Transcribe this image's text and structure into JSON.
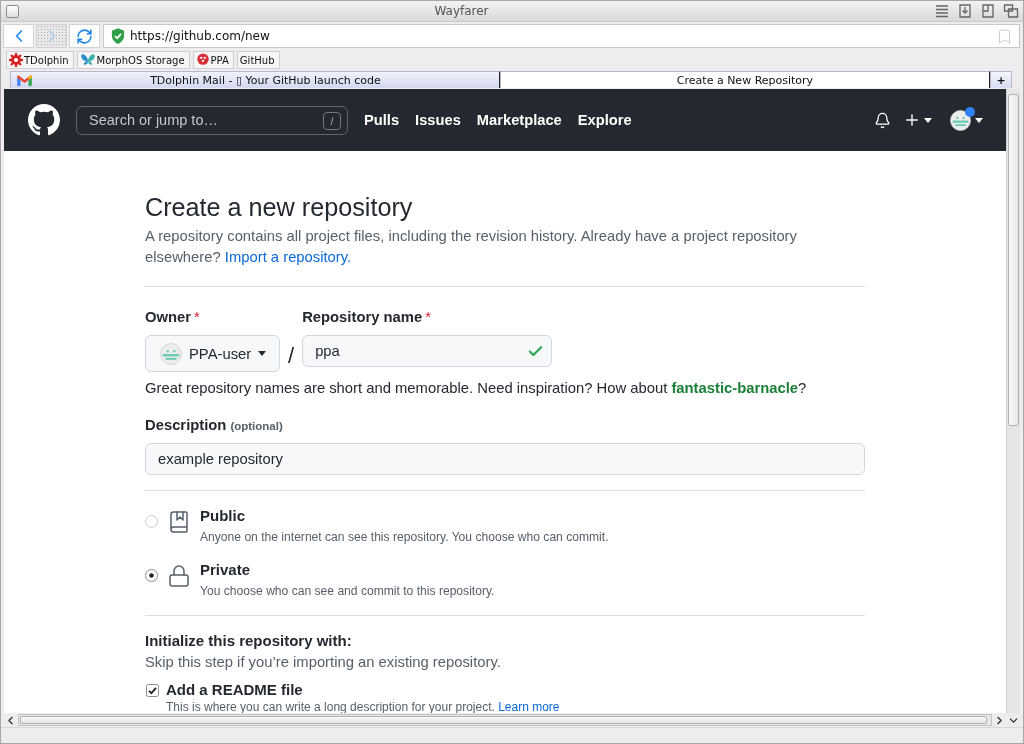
{
  "window": {
    "title": "Wayfarer"
  },
  "nav_buttons": [
    {
      "kind": "back",
      "disabled": false
    },
    {
      "kind": "forward",
      "disabled": true
    },
    {
      "kind": "reload",
      "disabled": false
    }
  ],
  "address_bar": {
    "url": "https://github.com/new",
    "secure": true
  },
  "bookmarks": [
    {
      "kind": "gear",
      "label": "TDolphin"
    },
    {
      "kind": "butterfly",
      "label": "MorphOS Storage"
    },
    {
      "kind": "badge",
      "label": "PPA"
    },
    {
      "kind": "plain",
      "label": "GitHub"
    }
  ],
  "tabs": [
    {
      "kind": "mail",
      "title": "TDolphin Mail - ▯ Your GitHub launch code",
      "selected": false
    },
    {
      "kind": "plain",
      "title": "Create a New Repository",
      "selected": true
    }
  ],
  "new_tab": "+",
  "github_header": {
    "search_placeholder": "Search or jump to…",
    "search_key": "/",
    "links": [
      "Pulls",
      "Issues",
      "Marketplace",
      "Explore"
    ],
    "avatar_badge": true
  },
  "page": {
    "title": "Create a new repository",
    "intro": "A repository contains all project files, including the revision history. Already have a project repository elsewhere?",
    "import_link": "Import a repository.",
    "owner": {
      "label": "Owner",
      "required_mark": "*",
      "value": "PPA-user"
    },
    "separator": "/",
    "repository_name": {
      "label": "Repository name",
      "required_mark": "*",
      "value": "ppa",
      "valid": true
    },
    "name_hint": "Great repository names are short and memorable. Need inspiration? How about **fantastic-barnacle**?",
    "description": {
      "label": "Description",
      "note": "(optional)",
      "value": "example repository"
    },
    "visibility": [
      {
        "kind": "public",
        "title": "Public",
        "text": "Anyone on the internet can see this repository. You choose who can commit.",
        "selected": false
      },
      {
        "kind": "private",
        "title": "Private",
        "text": "You choose who can see and commit to this repository.",
        "selected": true
      }
    ],
    "initialize": {
      "title": "Initialize this repository with:",
      "text": "Skip this step if you’re importing an existing repository.",
      "options": [
        {
          "label": "Add a README file",
          "checked": true,
          "text": "This is where you can write a long description for your project.",
          "link": "Learn more"
        }
      ]
    }
  }
}
